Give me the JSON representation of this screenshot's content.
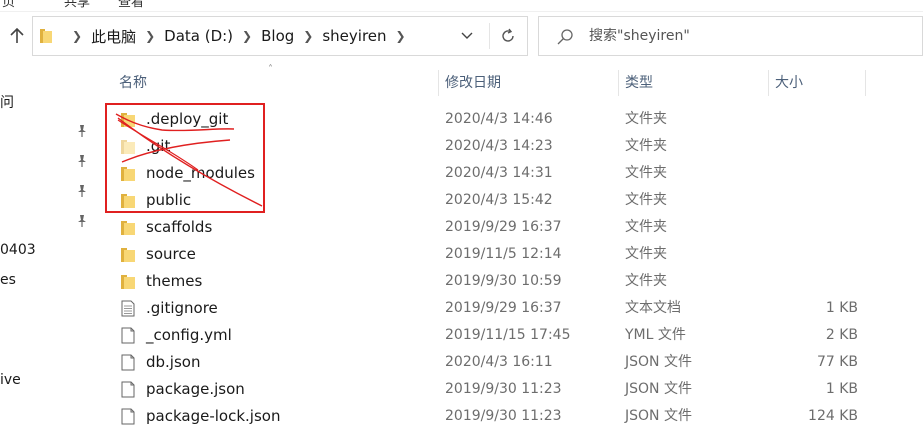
{
  "ribbon": {
    "fragments": [
      "页",
      "共享",
      "查看"
    ]
  },
  "toolbar": {
    "up_icon": "arrow-up-icon",
    "dropdown_icon": "chevron-down-icon",
    "refresh_icon": "refresh-icon"
  },
  "address": {
    "folder_icon": "folder-icon",
    "crumbs": [
      "此电脑",
      "Data (D:)",
      "Blog",
      "sheyiren"
    ]
  },
  "search": {
    "placeholder": "搜索\"sheyiren\""
  },
  "nav_pane": {
    "fragments": [
      "问",
      "0403",
      "es",
      "ive"
    ]
  },
  "columns": {
    "name": "名称",
    "modified": "修改日期",
    "type": "类型",
    "size": "大小"
  },
  "files": [
    {
      "name": ".deploy_git",
      "modified": "2020/4/3 14:46",
      "type": "文件夹",
      "size": "",
      "kind": "folder"
    },
    {
      "name": ".git",
      "modified": "2020/4/3 14:23",
      "type": "文件夹",
      "size": "",
      "kind": "folder-hidden"
    },
    {
      "name": "node_modules",
      "modified": "2020/4/3 14:31",
      "type": "文件夹",
      "size": "",
      "kind": "folder"
    },
    {
      "name": "public",
      "modified": "2020/4/3 15:42",
      "type": "文件夹",
      "size": "",
      "kind": "folder"
    },
    {
      "name": "scaffolds",
      "modified": "2019/9/29 16:37",
      "type": "文件夹",
      "size": "",
      "kind": "folder"
    },
    {
      "name": "source",
      "modified": "2019/11/5 12:14",
      "type": "文件夹",
      "size": "",
      "kind": "folder"
    },
    {
      "name": "themes",
      "modified": "2019/9/30 10:59",
      "type": "文件夹",
      "size": "",
      "kind": "folder"
    },
    {
      "name": ".gitignore",
      "modified": "2019/9/29 16:37",
      "type": "文本文档",
      "size": "1 KB",
      "kind": "text"
    },
    {
      "name": "_config.yml",
      "modified": "2019/11/15 17:45",
      "type": "YML 文件",
      "size": "2 KB",
      "kind": "file"
    },
    {
      "name": "db.json",
      "modified": "2020/4/3 16:11",
      "type": "JSON 文件",
      "size": "77 KB",
      "kind": "file"
    },
    {
      "name": "package.json",
      "modified": "2019/9/30 11:23",
      "type": "JSON 文件",
      "size": "1 KB",
      "kind": "file"
    },
    {
      "name": "package-lock.json",
      "modified": "2019/9/30 11:23",
      "type": "JSON 文件",
      "size": "124 KB",
      "kind": "file"
    }
  ],
  "colors": {
    "folder_yellow": "#f8d775",
    "folder_yellow_dark": "#e0b13e",
    "annotation_red": "#e02020",
    "header_text": "#4c607a"
  }
}
